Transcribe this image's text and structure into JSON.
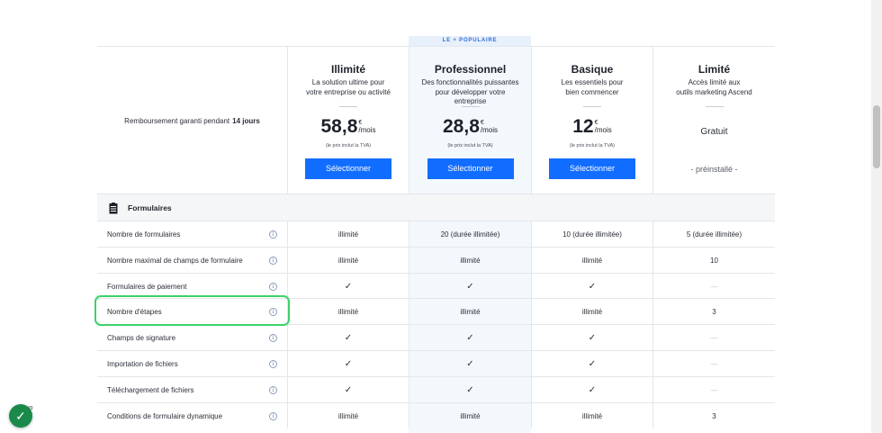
{
  "popular_badge": "LE + POPULAIRE",
  "guarantee": {
    "text": "Remboursement garanti pendant",
    "bold": "14 jours"
  },
  "plans": [
    {
      "name": "Illimité",
      "desc1": "La solution ultime pour",
      "desc2": "votre entreprise ou activité",
      "price": "58,8",
      "currency": "€",
      "period": "/mois",
      "vat": "(le prix inclut la TVA)",
      "button": "Sélectionner"
    },
    {
      "name": "Professionnel",
      "desc1": "Des fonctionnalités puissantes",
      "desc2": "pour développer votre entreprise",
      "price": "28,8",
      "currency": "€",
      "period": "/mois",
      "vat": "(le prix inclut la TVA)",
      "button": "Sélectionner"
    },
    {
      "name": "Basique",
      "desc1": "Les essentiels pour",
      "desc2": "bien commencer",
      "price": "12",
      "currency": "€",
      "period": "/mois",
      "vat": "(le prix inclut la TVA)",
      "button": "Sélectionner"
    },
    {
      "name": "Limité",
      "desc1": "Accès limité aux",
      "desc2": "outils marketing Ascend",
      "free": "Gratuit",
      "preinstalled": "- préinstallé -"
    }
  ],
  "section": {
    "title": "Formulaires",
    "icon": "form-list-icon"
  },
  "rows": [
    {
      "label": "Nombre de formulaires",
      "values": [
        "illimité",
        "20 (durée illimitée)",
        "10 (durée illimitée)",
        "5 (durée illimitée)"
      ]
    },
    {
      "label": "Nombre maximal de champs de formulaire",
      "values": [
        "illimité",
        "illimité",
        "illimité",
        "10"
      ]
    },
    {
      "label": "Formulaires de paiement",
      "values": [
        "✓",
        "✓",
        "✓",
        "—"
      ]
    },
    {
      "label": "Nombre d'étapes",
      "values": [
        "illimité",
        "illimité",
        "illimité",
        "3"
      ]
    },
    {
      "label": "Champs de signature",
      "values": [
        "✓",
        "✓",
        "✓",
        "—"
      ]
    },
    {
      "label": "Importation de fichiers",
      "values": [
        "✓",
        "✓",
        "✓",
        "—"
      ]
    },
    {
      "label": "Téléchargement de fichiers",
      "values": [
        "✓",
        "✓",
        "✓",
        "—"
      ]
    },
    {
      "label": "Conditions de formulaire dynamique",
      "values": [
        "illimité",
        "illimité",
        "illimité",
        "3"
      ]
    }
  ],
  "info_icon": "i",
  "status_badge": {
    "icon": "✓",
    "count": "79"
  },
  "colors": {
    "accent": "#116dff",
    "highlight": "#3cd26a",
    "popular_bg": "#f3f8fd",
    "badge": "#1a8a4b"
  }
}
